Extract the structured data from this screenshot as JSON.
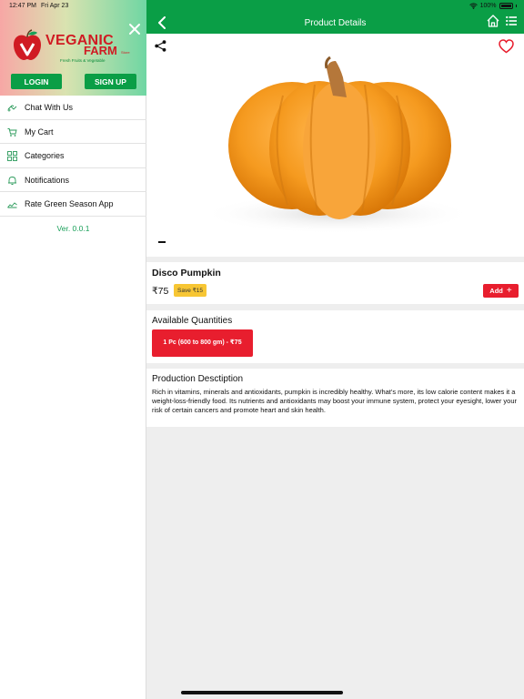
{
  "status": {
    "time": "12:47 PM",
    "date": "Fri Apr 23",
    "battery": "100%"
  },
  "sidebar": {
    "brand_line1": "VEGANIC",
    "brand_line2": "FARM",
    "brand_sup": "Store",
    "tagline": "Fresh Fruits & Vegetable",
    "login_label": "LOGIN",
    "signup_label": "SIGN UP",
    "items": [
      {
        "label": "Chat With Us",
        "icon": "chat-icon"
      },
      {
        "label": "My Cart",
        "icon": "cart-icon"
      },
      {
        "label": "Categories",
        "icon": "categories-icon"
      },
      {
        "label": "Notifications",
        "icon": "bell-icon"
      },
      {
        "label": "Rate Green Season App",
        "icon": "rate-icon"
      }
    ],
    "version": "Ver. 0.0.1"
  },
  "header": {
    "title": "Product Details"
  },
  "product": {
    "name": "Disco Pumpkin",
    "price": "₹75",
    "save": "Save ₹15",
    "add_label": "Add",
    "quantities_title": "Available Quantities",
    "quantity_option": "1 Pc (600 to 800 gm) - ₹75",
    "description_title": "Production Desctiption",
    "description": "Rich in vitamins, minerals and antioxidants, pumpkin is incredibly healthy. What's more, its low calorie content makes it a weight-loss-friendly food. Its nutrients and antioxidants may boost your immune system, protect your eyesight, lower your risk of certain cancers and promote heart and skin health."
  },
  "colors": {
    "brand_green": "#0a9e46",
    "accent_red": "#e81e2e",
    "save_yellow": "#f7c634"
  }
}
